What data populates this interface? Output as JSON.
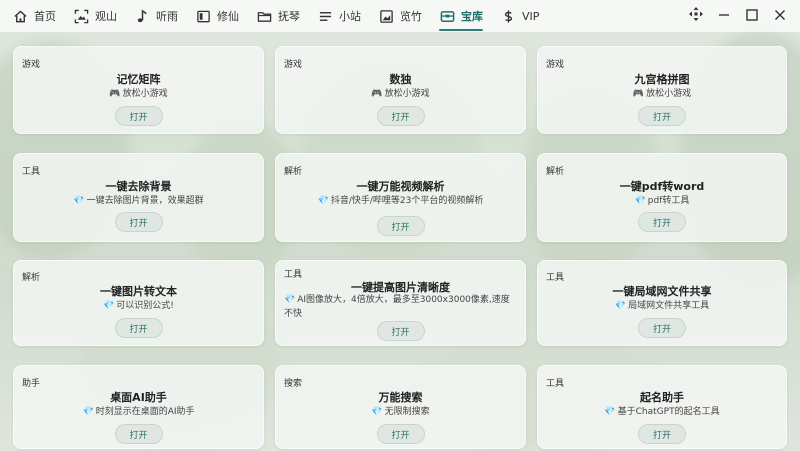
{
  "nav": {
    "items": [
      {
        "label": "首页",
        "icon": "home-icon"
      },
      {
        "label": "观山",
        "icon": "mountain-frame-icon"
      },
      {
        "label": "听雨",
        "icon": "music-note-icon"
      },
      {
        "label": "修仙",
        "icon": "book-icon"
      },
      {
        "label": "抚琴",
        "icon": "folder-icon"
      },
      {
        "label": "小站",
        "icon": "list-icon"
      },
      {
        "label": "览竹",
        "icon": "image-icon"
      },
      {
        "label": "宝库",
        "icon": "treasure-box-icon"
      },
      {
        "label": "VIP",
        "icon": "dollar-icon"
      }
    ],
    "active_index": 7
  },
  "colors": {
    "accent": "#2f7d77",
    "diamond": "#4aa8d8",
    "gamepad": "#555555"
  },
  "cards": [
    {
      "category": "游戏",
      "title": "记忆矩阵",
      "desc": "放松小游戏",
      "prefix_icon": "gamepad-icon",
      "button": "打开"
    },
    {
      "category": "游戏",
      "title": "数独",
      "desc": "放松小游戏",
      "prefix_icon": "gamepad-icon",
      "button": "打开"
    },
    {
      "category": "游戏",
      "title": "九宫格拼图",
      "desc": "放松小游戏",
      "prefix_icon": "gamepad-icon",
      "button": "打开"
    },
    {
      "category": "工具",
      "title": "一键去除背景",
      "desc": "一键去除图片背景，效果超群",
      "prefix_icon": "diamond-icon",
      "button": "打开"
    },
    {
      "category": "解析",
      "title": "一键万能视频解析",
      "desc": "抖音/快手/哔哩等23个平台的视频解析",
      "prefix_icon": "diamond-icon",
      "button": "打开"
    },
    {
      "category": "解析",
      "title": "一键pdf转word",
      "desc": "pdf转工具",
      "prefix_icon": "diamond-icon",
      "button": "打开"
    },
    {
      "category": "解析",
      "title": "一键图片转文本",
      "desc": "可以识别公式!",
      "prefix_icon": "diamond-icon",
      "button": "打开"
    },
    {
      "category": "工具",
      "title": "一键提高图片清晰度",
      "desc": "AI图像放大，4倍放大，最多至3000x3000像素,速度不快",
      "prefix_icon": "diamond-icon",
      "button": "打开"
    },
    {
      "category": "工具",
      "title": "一键局域网文件共享",
      "desc": "局域网文件共享工具",
      "prefix_icon": "diamond-icon",
      "button": "打开"
    },
    {
      "category": "助手",
      "title": "桌面AI助手",
      "desc": "时刻显示在桌面的AI助手",
      "prefix_icon": "diamond-icon",
      "button": "打开"
    },
    {
      "category": "搜索",
      "title": "万能搜索",
      "desc": "无限制搜索",
      "prefix_icon": "diamond-icon",
      "button": "打开"
    },
    {
      "category": "工具",
      "title": "起名助手",
      "desc": "基于ChatGPT的起名工具",
      "prefix_icon": "diamond-icon",
      "button": "打开"
    }
  ]
}
